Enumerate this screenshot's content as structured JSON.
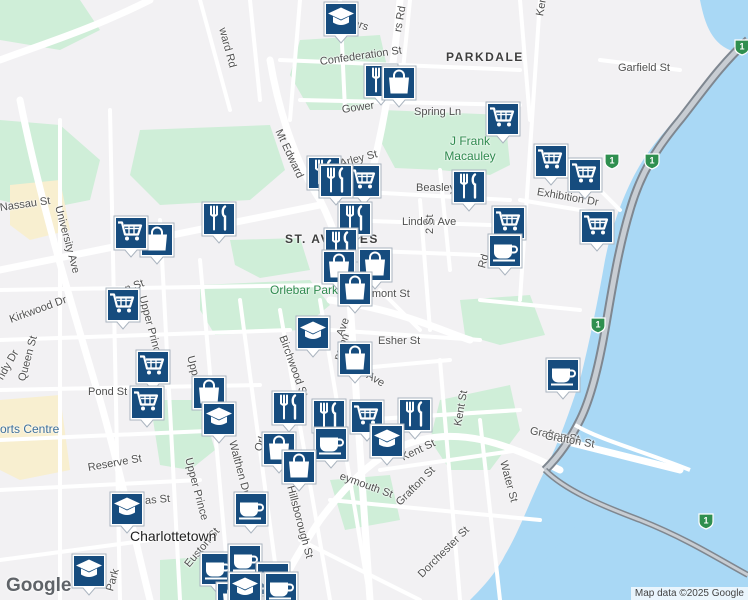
{
  "map": {
    "neighbourhoods": [
      "PARKDALE",
      "ST. AVENUES"
    ],
    "city": "Charlottetown",
    "park_labels": [
      "J Frank Macauley",
      "Orlebar Park"
    ],
    "sports_label": "orts Centre",
    "attribution": "Map data ©2025 Google",
    "logo": "Google",
    "colors": {
      "water": "#a9d8f5",
      "land": "#f2f1f3",
      "park": "#cfeed8",
      "road": "#ffffff",
      "highway": "#7f8790",
      "pin": "#164c7e",
      "pin_icon": "#ffffff",
      "campus": "#f8efd0"
    }
  },
  "streets": [
    "ward Rd",
    "Palmers",
    "Confederation St",
    "Garfield St",
    "Gower",
    "Spring Ln",
    "Mt Edward",
    "Beasley Ave",
    "Exhibition Dr",
    "Linden Ave",
    "2 St",
    "Rd",
    "Nassau St",
    "University Ave",
    "Allen St",
    "Upper Prince",
    "Kirkwood Dr",
    "Queen St",
    "Pond St",
    "Birchwood St",
    "Esher St",
    "Belmont St",
    "ory Ave",
    "Kent St",
    "Grafton St",
    "Water St",
    "Reserve St",
    "Walthen Dr",
    "Upper Prince",
    "Hillsborough St",
    "eymouth St",
    "Euston St",
    "Dorchester St",
    "Park",
    "ndy Dr",
    "Kent St",
    "Grafton St",
    "rs Rd",
    "Ker",
    "Arley St",
    "ngton",
    "Ave",
    "Orl",
    "as St",
    "Upper Prince",
    "Grafton St"
  ],
  "pins": [
    {
      "icon": "school-icon"
    },
    {
      "icon": "restaurant-icon"
    },
    {
      "icon": "shopping-bag-icon"
    },
    {
      "icon": "grocery-cart-icon"
    },
    {
      "icon": "grocery-cart-icon"
    },
    {
      "icon": "grocery-cart-icon"
    },
    {
      "icon": "restaurant-icon"
    },
    {
      "icon": "grocery-cart-icon"
    },
    {
      "icon": "restaurant-icon"
    },
    {
      "icon": "restaurant-icon"
    },
    {
      "icon": "grocery-cart-icon"
    },
    {
      "icon": "grocery-cart-icon"
    },
    {
      "icon": "shopping-bag-icon"
    },
    {
      "icon": "restaurant-icon"
    },
    {
      "icon": "restaurant-icon"
    },
    {
      "icon": "restaurant-icon"
    },
    {
      "icon": "grocery-cart-icon"
    },
    {
      "icon": "coffee-icon"
    },
    {
      "icon": "grocery-cart-icon"
    },
    {
      "icon": "shopping-bag-icon"
    },
    {
      "icon": "shopping-bag-icon"
    },
    {
      "icon": "shopping-bag-icon"
    },
    {
      "icon": "grocery-cart-icon"
    },
    {
      "icon": "school-icon"
    },
    {
      "icon": "shopping-bag-icon"
    },
    {
      "icon": "grocery-cart-icon"
    },
    {
      "icon": "shopping-bag-icon"
    },
    {
      "icon": "grocery-cart-icon"
    },
    {
      "icon": "school-icon"
    },
    {
      "icon": "restaurant-icon"
    },
    {
      "icon": "restaurant-icon"
    },
    {
      "icon": "grocery-cart-icon"
    },
    {
      "icon": "restaurant-icon"
    },
    {
      "icon": "coffee-icon"
    },
    {
      "icon": "shopping-bag-icon"
    },
    {
      "icon": "coffee-icon"
    },
    {
      "icon": "school-icon"
    },
    {
      "icon": "shopping-bag-icon"
    },
    {
      "icon": "school-icon"
    },
    {
      "icon": "coffee-icon"
    },
    {
      "icon": "coffee-icon"
    },
    {
      "icon": "school-icon"
    },
    {
      "icon": "coffee-icon"
    },
    {
      "icon": "shopping-bag-icon"
    },
    {
      "icon": "coffee-icon"
    },
    {
      "icon": "school-icon"
    },
    {
      "icon": "coffee-icon"
    }
  ],
  "highway_shields": [
    "1",
    "1",
    "1",
    "1",
    "1"
  ]
}
